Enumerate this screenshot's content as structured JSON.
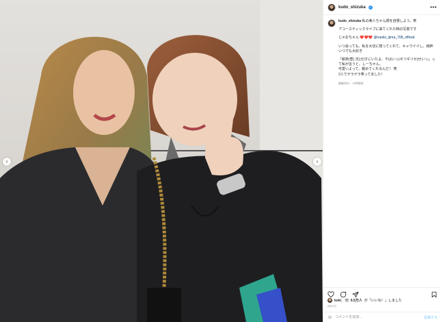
{
  "post": {
    "username": "kudo_shizuka",
    "photo_alt": "Two women posing together, one making a peace sign"
  },
  "caption": {
    "lines": [
      "私の美人ちゃん顔を自慢しよう。笑",
      "アコースティックライブに来てくれた時の写真です",
      "じゃおちゃん",
      "いつ会っても、私を大切に想ってくれて、キャワイイし、純粋",
      "いつでも大好き",
      "「紺奈(惹) 次(ガ)すにいたよ、やばいっ(ギリギリセ)ぜいっ」って私が言うと、しーちゃん、",
      "可愛いよって、勧めてくれるんだ！ 笑",
      "2人でゲラゲラ笑ってました！"
    ],
    "mention": "@naoko_ijima_708_official",
    "hearts": "❤️❤️❤️",
    "timestamp": "編集済み・19時間前"
  },
  "likes": {
    "liker": "koki_",
    "text_mid": "他",
    "count": "6.5万人",
    "text_end": "が「いいね！」しました"
  },
  "date": "8月22日",
  "comment": {
    "placeholder": "コメントを追加...",
    "post_label": "投稿する"
  },
  "icons": {
    "like": "heart-icon",
    "comment": "comment-icon",
    "share": "share-icon",
    "save": "bookmark-icon",
    "more": "more-icon",
    "emoji": "emoji-icon"
  }
}
